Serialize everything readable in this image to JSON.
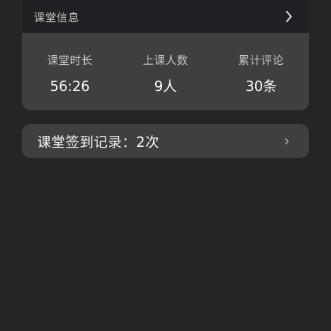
{
  "class_info": {
    "title": "课堂信息",
    "stats": [
      {
        "label": "课堂时长",
        "value": "56:26"
      },
      {
        "label": "上课人数",
        "value": "9人"
      },
      {
        "label": "累计评论",
        "value": "30条"
      }
    ]
  },
  "checkin": {
    "label": "课堂签到记录：2次"
  },
  "colors": {
    "background": "#232526",
    "card": "#3e3f41",
    "header": "#1f2023"
  }
}
